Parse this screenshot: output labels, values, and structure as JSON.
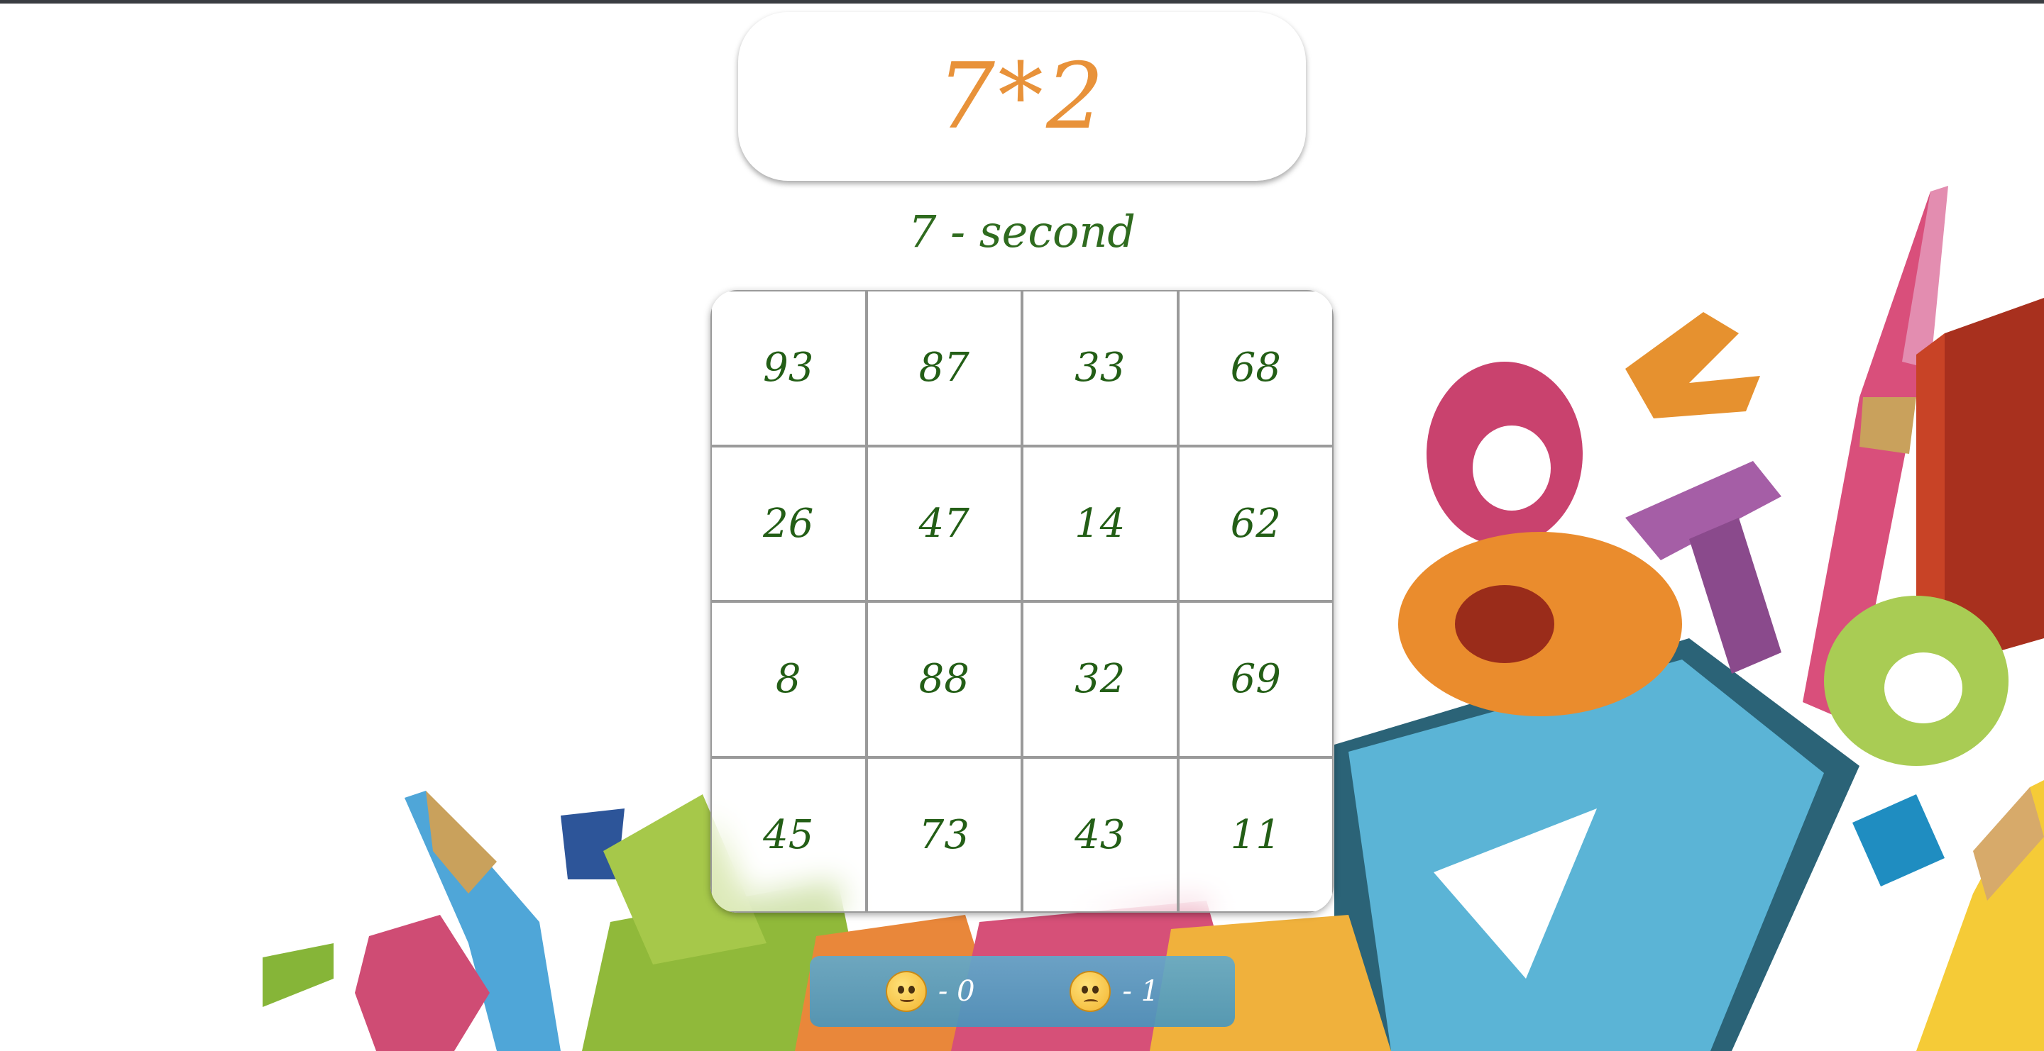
{
  "question": "7*2",
  "timer_text": "7 - second",
  "grid": {
    "cells": [
      93,
      87,
      33,
      68,
      26,
      47,
      14,
      62,
      8,
      88,
      32,
      69,
      45,
      73,
      43,
      11
    ]
  },
  "score": {
    "correct_label": "- 0",
    "wrong_label": "- 1",
    "correct_icon": "thinking-face-icon",
    "wrong_icon": "pleading-face-icon"
  },
  "colors": {
    "question": "#e8923a",
    "numbers": "#235e16",
    "score_bar": "#5fa8cc"
  }
}
